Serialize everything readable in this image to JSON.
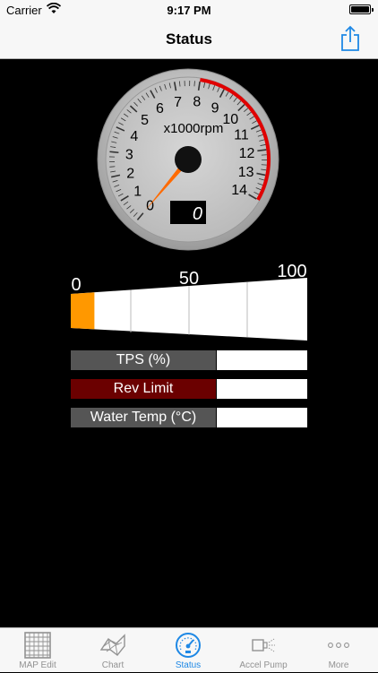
{
  "status_bar": {
    "carrier": "Carrier",
    "time": "9:17 PM",
    "icons": [
      "wifi-icon",
      "battery-icon"
    ]
  },
  "nav": {
    "title": "Status",
    "right_icon": "share-icon",
    "tint": "#1e88e5"
  },
  "tachometer": {
    "unit_label": "x1000rpm",
    "scale_labels": [
      "0",
      "1",
      "2",
      "3",
      "4",
      "5",
      "6",
      "7",
      "8",
      "9",
      "10",
      "11",
      "12",
      "13",
      "14"
    ],
    "redline_from": 8,
    "max": 14,
    "needle_value": 0,
    "digital_readout": "0",
    "needle_color": "#ff6a00",
    "redline_color": "#e00000"
  },
  "throttle_bar": {
    "scale_labels": [
      "0",
      "50",
      "100"
    ],
    "fill_fraction": 0.1,
    "fill_color": "#ff9800"
  },
  "readouts": [
    {
      "label": "TPS (%)",
      "value": "",
      "color": "#555555"
    },
    {
      "label": "Rev Limit",
      "value": "",
      "color": "#6b0000"
    },
    {
      "label": "Water Temp (°C)",
      "value": "",
      "color": "#555555"
    }
  ],
  "tabs": [
    {
      "label": "MAP Edit",
      "icon": "grid-icon",
      "active": false
    },
    {
      "label": "Chart",
      "icon": "chart-surface-icon",
      "active": false
    },
    {
      "label": "Status",
      "icon": "gauge-icon",
      "active": true
    },
    {
      "label": "Accel Pump",
      "icon": "injector-icon",
      "active": false
    },
    {
      "label": "More",
      "icon": "more-icon",
      "active": false
    }
  ],
  "colors": {
    "background": "#000000",
    "bars": "#f7f7f7",
    "tab_active": "#1e88e5",
    "tab_inactive": "#929292"
  }
}
